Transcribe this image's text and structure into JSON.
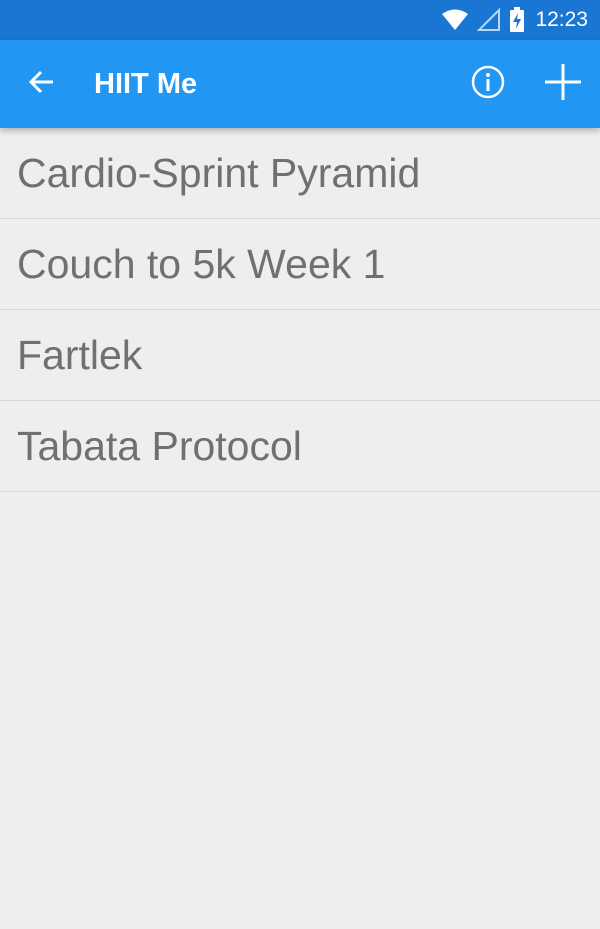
{
  "status_bar": {
    "time": "12:23",
    "icons": [
      "wifi-icon",
      "signal-icon",
      "battery-charging-icon"
    ]
  },
  "app_bar": {
    "title": "HIIT Me",
    "back_icon": "arrow-back-icon",
    "info_icon": "info-icon",
    "add_icon": "add-icon"
  },
  "workouts": [
    {
      "label": "Cardio-Sprint Pyramid"
    },
    {
      "label": "Couch to 5k Week 1"
    },
    {
      "label": "Fartlek"
    },
    {
      "label": "Tabata Protocol"
    }
  ],
  "colors": {
    "status_bar": "#1976d2",
    "app_bar": "#2196f3",
    "background": "#eeeeee",
    "item_text": "#707070",
    "divider": "#d6d6d6"
  }
}
